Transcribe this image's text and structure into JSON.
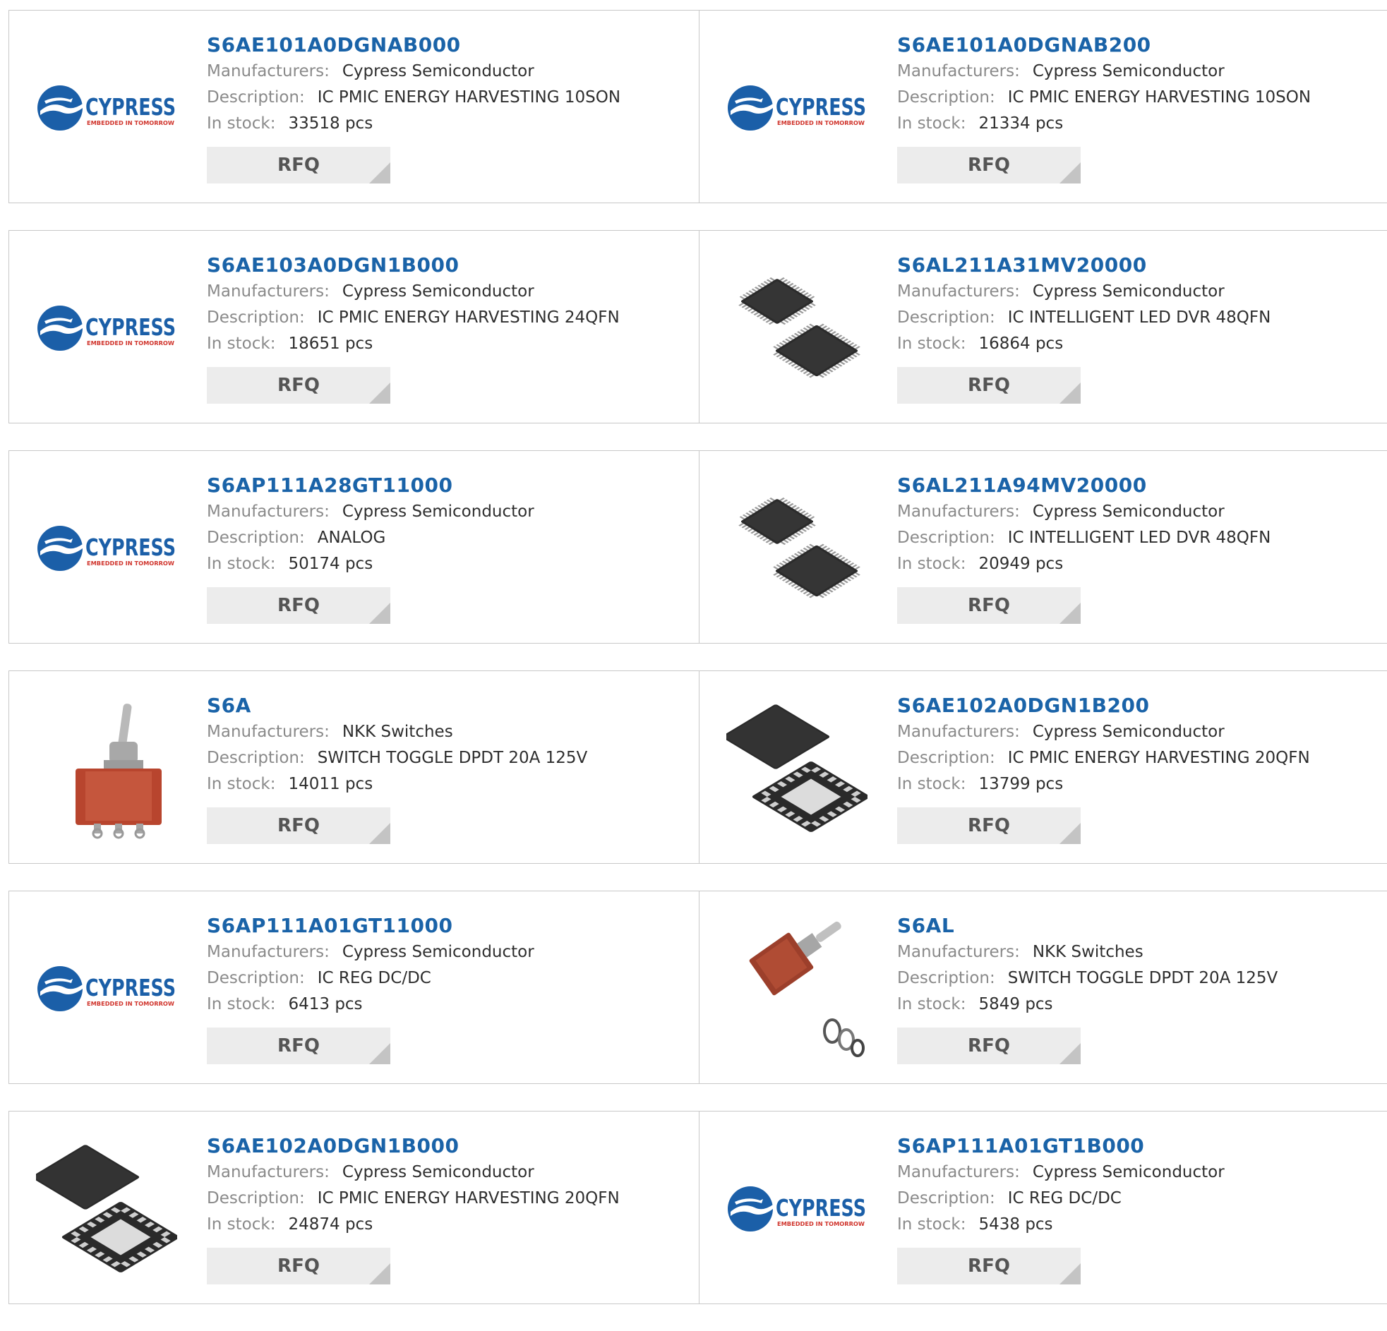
{
  "products": [
    {
      "part": "S6AE101A0DGNAB000",
      "image": "cypress-logo",
      "manufacturer_label": "Manufacturers:",
      "manufacturer": "Cypress Semiconductor",
      "description_label": "Description:",
      "description": "IC PMIC ENERGY HARVESTING 10SON",
      "stock_label": "In stock:",
      "stock": "33518 pcs",
      "rfq": "RFQ"
    },
    {
      "part": "S6AE101A0DGNAB200",
      "image": "cypress-logo",
      "manufacturer_label": "Manufacturers:",
      "manufacturer": "Cypress Semiconductor",
      "description_label": "Description:",
      "description": "IC PMIC ENERGY HARVESTING 10SON",
      "stock_label": "In stock:",
      "stock": "21334 pcs",
      "rfq": "RFQ"
    },
    {
      "part": "S6AE103A0DGN1B000",
      "image": "cypress-logo",
      "manufacturer_label": "Manufacturers:",
      "manufacturer": "Cypress Semiconductor",
      "description_label": "Description:",
      "description": "IC PMIC ENERGY HARVESTING 24QFN",
      "stock_label": "In stock:",
      "stock": "18651 pcs",
      "rfq": "RFQ"
    },
    {
      "part": "S6AL211A31MV20000",
      "image": "qfp-chip",
      "manufacturer_label": "Manufacturers:",
      "manufacturer": "Cypress Semiconductor",
      "description_label": "Description:",
      "description": "IC INTELLIGENT LED DVR 48QFN",
      "stock_label": "In stock:",
      "stock": "16864 pcs",
      "rfq": "RFQ"
    },
    {
      "part": "S6AP111A28GT11000",
      "image": "cypress-logo",
      "manufacturer_label": "Manufacturers:",
      "manufacturer": "Cypress Semiconductor",
      "description_label": "Description:",
      "description": "ANALOG",
      "stock_label": "In stock:",
      "stock": "50174 pcs",
      "rfq": "RFQ"
    },
    {
      "part": "S6AL211A94MV20000",
      "image": "qfp-chip",
      "manufacturer_label": "Manufacturers:",
      "manufacturer": "Cypress Semiconductor",
      "description_label": "Description:",
      "description": "IC INTELLIGENT LED DVR 48QFN",
      "stock_label": "In stock:",
      "stock": "20949 pcs",
      "rfq": "RFQ"
    },
    {
      "part": "S6A",
      "image": "toggle-switch",
      "manufacturer_label": "Manufacturers:",
      "manufacturer": "NKK Switches",
      "description_label": "Description:",
      "description": "SWITCH TOGGLE DPDT 20A 125V",
      "stock_label": "In stock:",
      "stock": "14011 pcs",
      "rfq": "RFQ"
    },
    {
      "part": "S6AE102A0DGN1B200",
      "image": "qfn-chip",
      "manufacturer_label": "Manufacturers:",
      "manufacturer": "Cypress Semiconductor",
      "description_label": "Description:",
      "description": "IC PMIC ENERGY HARVESTING 20QFN",
      "stock_label": "In stock:",
      "stock": "13799 pcs",
      "rfq": "RFQ"
    },
    {
      "part": "S6AP111A01GT11000",
      "image": "cypress-logo",
      "manufacturer_label": "Manufacturers:",
      "manufacturer": "Cypress Semiconductor",
      "description_label": "Description:",
      "description": "IC REG DC/DC",
      "stock_label": "In stock:",
      "stock": "6413 pcs",
      "rfq": "RFQ"
    },
    {
      "part": "S6AL",
      "image": "toggle-switch-side",
      "manufacturer_label": "Manufacturers:",
      "manufacturer": "NKK Switches",
      "description_label": "Description:",
      "description": "SWITCH TOGGLE DPDT 20A 125V",
      "stock_label": "In stock:",
      "stock": "5849 pcs",
      "rfq": "RFQ"
    },
    {
      "part": "S6AE102A0DGN1B000",
      "image": "qfn-chip",
      "manufacturer_label": "Manufacturers:",
      "manufacturer": "Cypress Semiconductor",
      "description_label": "Description:",
      "description": "IC PMIC ENERGY HARVESTING 20QFN",
      "stock_label": "In stock:",
      "stock": "24874 pcs",
      "rfq": "RFQ"
    },
    {
      "part": "S6AP111A01GT1B000",
      "image": "cypress-logo",
      "manufacturer_label": "Manufacturers:",
      "manufacturer": "Cypress Semiconductor",
      "description_label": "Description:",
      "description": "IC REG DC/DC",
      "stock_label": "In stock:",
      "stock": "5438 pcs",
      "rfq": "RFQ"
    }
  ],
  "logo": {
    "brand": "CYPRESS",
    "tagline": "EMBEDDED IN TOMORROW",
    "brand_color": "#1b5fa8",
    "tagline_color": "#d0342c"
  },
  "colors": {
    "part_link": "#1a63a8",
    "label": "#8a8a8a",
    "value": "#2e2e2e",
    "rfq_bg": "#ececec",
    "border": "#c8c8c8"
  }
}
